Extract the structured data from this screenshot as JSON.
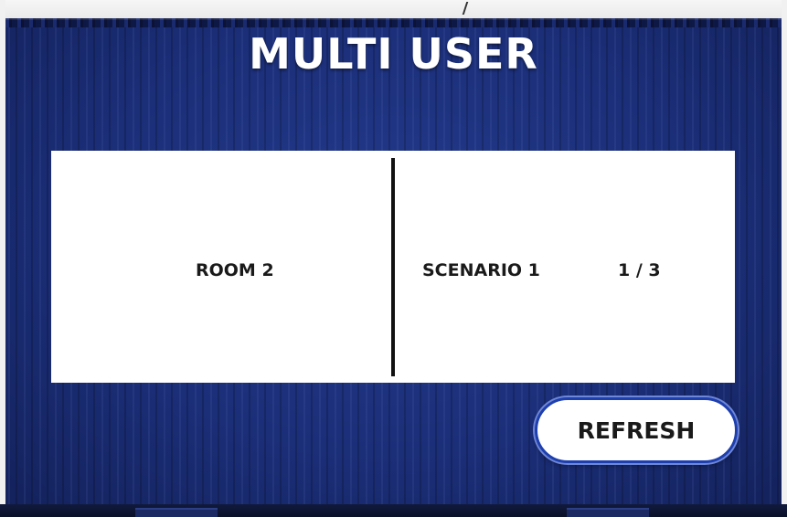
{
  "screen": {
    "title": "MULTI USER"
  },
  "room_list": [
    {
      "room_name": "ROOM 2",
      "scenario": "SCENARIO 1",
      "players": "1 / 3"
    }
  ],
  "actions": {
    "refresh_label": "REFRESH"
  },
  "colors": {
    "background": "#1b2e78",
    "card": "#ffffff",
    "button_border": "#1e3fae",
    "text_dark": "#1a1a1a"
  }
}
